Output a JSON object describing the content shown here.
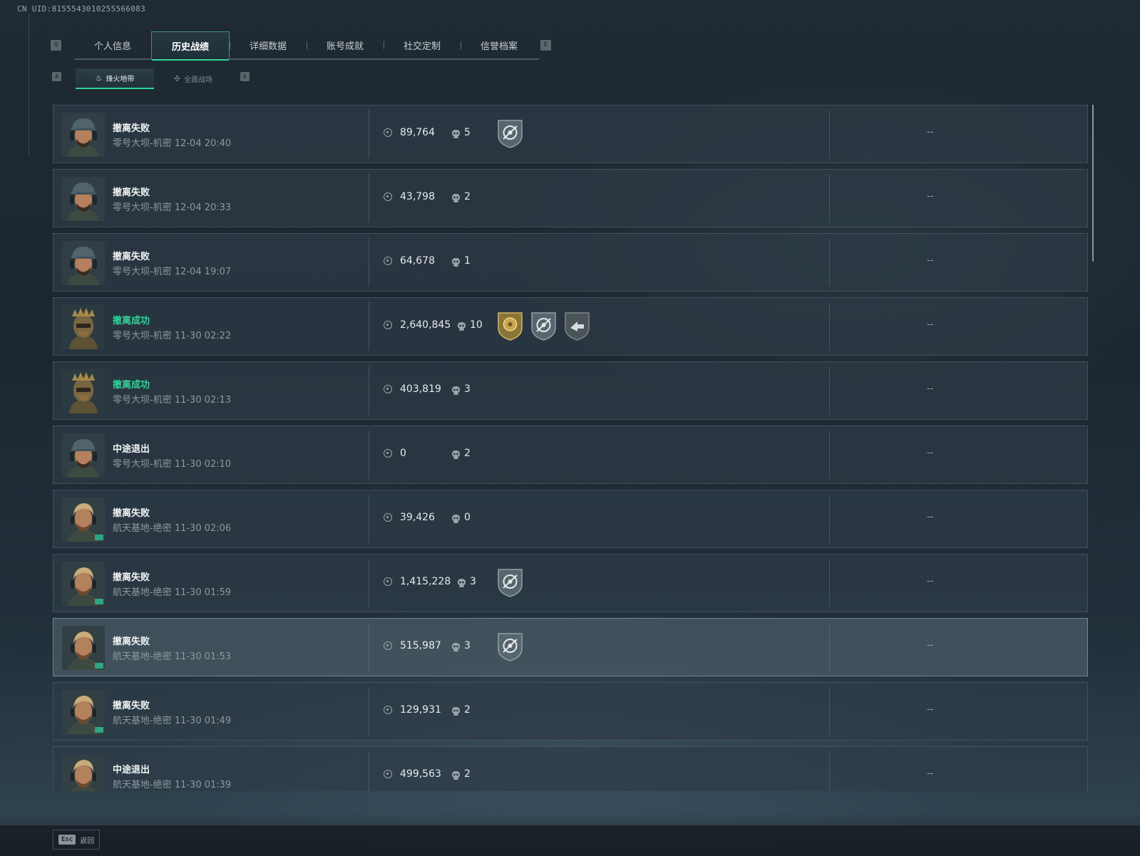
{
  "uid": "CN UID:8155543010255566083",
  "header": {
    "left_key": "Q",
    "right_key": "E",
    "tabs": [
      {
        "label": "个人信息",
        "active": false
      },
      {
        "label": "历史战绩",
        "active": true
      },
      {
        "label": "详细数据",
        "active": false
      },
      {
        "label": "账号成就",
        "active": false
      },
      {
        "label": "社交定制",
        "active": false
      },
      {
        "label": "信誉档案",
        "active": false
      }
    ]
  },
  "subnav": {
    "left_key": "A",
    "right_key": "D",
    "tabs": [
      {
        "label": "烽火地带",
        "icon": "flame-zone-icon",
        "active": true
      },
      {
        "label": "全面战场",
        "icon": "battlefield-icon",
        "active": false
      }
    ]
  },
  "matches": [
    {
      "status": "撤离失败",
      "result": "fail",
      "subtitle": "零号大坝-机密 12-04 20:40",
      "value": "89,764",
      "kills": "5",
      "avatar": "cap-operator",
      "badges": [
        "shield-target"
      ],
      "extra": "--"
    },
    {
      "status": "撤离失败",
      "result": "fail",
      "subtitle": "零号大坝-机密 12-04 20:33",
      "value": "43,798",
      "kills": "2",
      "avatar": "cap-operator",
      "badges": [],
      "extra": "--"
    },
    {
      "status": "撤离失败",
      "result": "fail",
      "subtitle": "零号大坝-机密 12-04 19:07",
      "value": "64,678",
      "kills": "1",
      "avatar": "cap-operator",
      "badges": [],
      "extra": "--"
    },
    {
      "status": "撤离成功",
      "result": "success",
      "subtitle": "零号大坝-机密 11-30 02:22",
      "value": "2,640,845",
      "kills": "10",
      "avatar": "crown-operator",
      "badges": [
        "gold-medal",
        "shield-target",
        "shield-arrow"
      ],
      "extra": "--"
    },
    {
      "status": "撤离成功",
      "result": "success",
      "subtitle": "零号大坝-机密 11-30 02:13",
      "value": "403,819",
      "kills": "3",
      "avatar": "crown-operator",
      "badges": [],
      "extra": "--"
    },
    {
      "status": "中途退出",
      "result": "quit",
      "subtitle": "零号大坝-机密 11-30 02:10",
      "value": "0",
      "kills": "2",
      "avatar": "cap-operator",
      "badges": [],
      "extra": "--"
    },
    {
      "status": "撤离失败",
      "result": "fail",
      "subtitle": "航天基地-绝密 11-30 02:06",
      "value": "39,426",
      "kills": "0",
      "avatar": "blond-operator",
      "badges": [],
      "extra": "--"
    },
    {
      "status": "撤离失败",
      "result": "fail",
      "subtitle": "航天基地-绝密 11-30 01:59",
      "value": "1,415,228",
      "kills": "3",
      "avatar": "blond-operator",
      "badges": [
        "shield-target"
      ],
      "extra": "--"
    },
    {
      "status": "撤离失败",
      "result": "fail",
      "subtitle": "航天基地-绝密 11-30 01:53",
      "value": "515,987",
      "kills": "3",
      "avatar": "blond-operator",
      "badges": [
        "shield-target"
      ],
      "extra": "--",
      "highlighted": true
    },
    {
      "status": "撤离失败",
      "result": "fail",
      "subtitle": "航天基地-绝密 11-30 01:49",
      "value": "129,931",
      "kills": "2",
      "avatar": "blond-operator",
      "badges": [],
      "extra": "--"
    },
    {
      "status": "中途退出",
      "result": "quit",
      "subtitle": "航天基地-绝密 11-30 01:39",
      "value": "499,563",
      "kills": "2",
      "avatar": "blond-operator",
      "badges": [],
      "extra": "--"
    }
  ],
  "footer": {
    "key": "Esc",
    "label": "返回"
  },
  "colors": {
    "accent": "#2fd49a",
    "success": "#2fd49a",
    "text": "#e6eaec",
    "muted": "#8e989d"
  }
}
